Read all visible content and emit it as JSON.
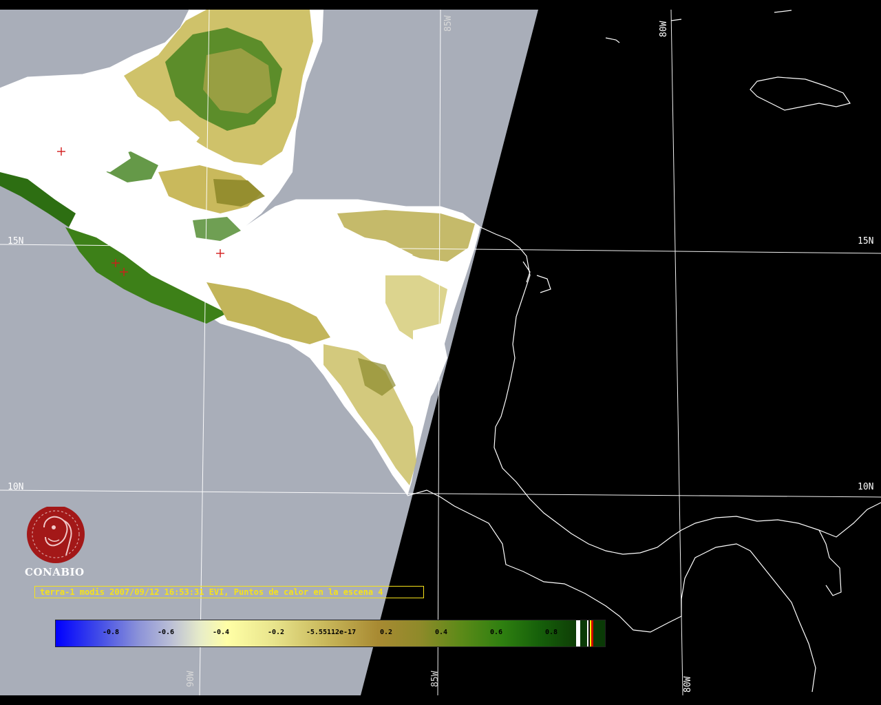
{
  "map": {
    "grid_labels": {
      "lat_15_left": "15N",
      "lat_15_right": "15N",
      "lat_10_left": "10N",
      "lat_10_right": "10N",
      "lon_85_top": "85W",
      "lon_80_top": "80W",
      "lon_90_bottom": "90W",
      "lon_85_bottom": "85W",
      "lon_80_bottom": "80W"
    },
    "logo": {
      "text": "CONABIO"
    },
    "caption": "terra-1 modis 2007/09/12 16:53:31 EVI, Puntos de calor en la escena 4",
    "colorbar": {
      "tick_labels": [
        "-0.8",
        "-0.6",
        "-0.4",
        "-0.2",
        "-5.55112e-17",
        "0.2",
        "0.4",
        "0.6",
        "0.8"
      ],
      "tick_values": [
        -0.8,
        -0.6,
        -0.4,
        -0.2,
        -5.55112e-17,
        0.2,
        0.4,
        0.6,
        0.8
      ],
      "range": [
        -1.0,
        1.0
      ],
      "extra_classes_colors": [
        "#ffffff",
        "#000000",
        "#ffff00",
        "#cc0000"
      ]
    },
    "colors": {
      "ocean_swath": "#a9aeb9",
      "cloud": "#ffffff",
      "outside_swath": "#000000",
      "coastline": "#ffffff",
      "gridline": "#ffffff",
      "vegetation_low": "#c9bd62",
      "vegetation_high": "#2d6e12",
      "hotspot": "#d21c1c",
      "caption_text": "#f6e21a",
      "logo": "#a31818"
    },
    "hotspots_count": 4
  }
}
